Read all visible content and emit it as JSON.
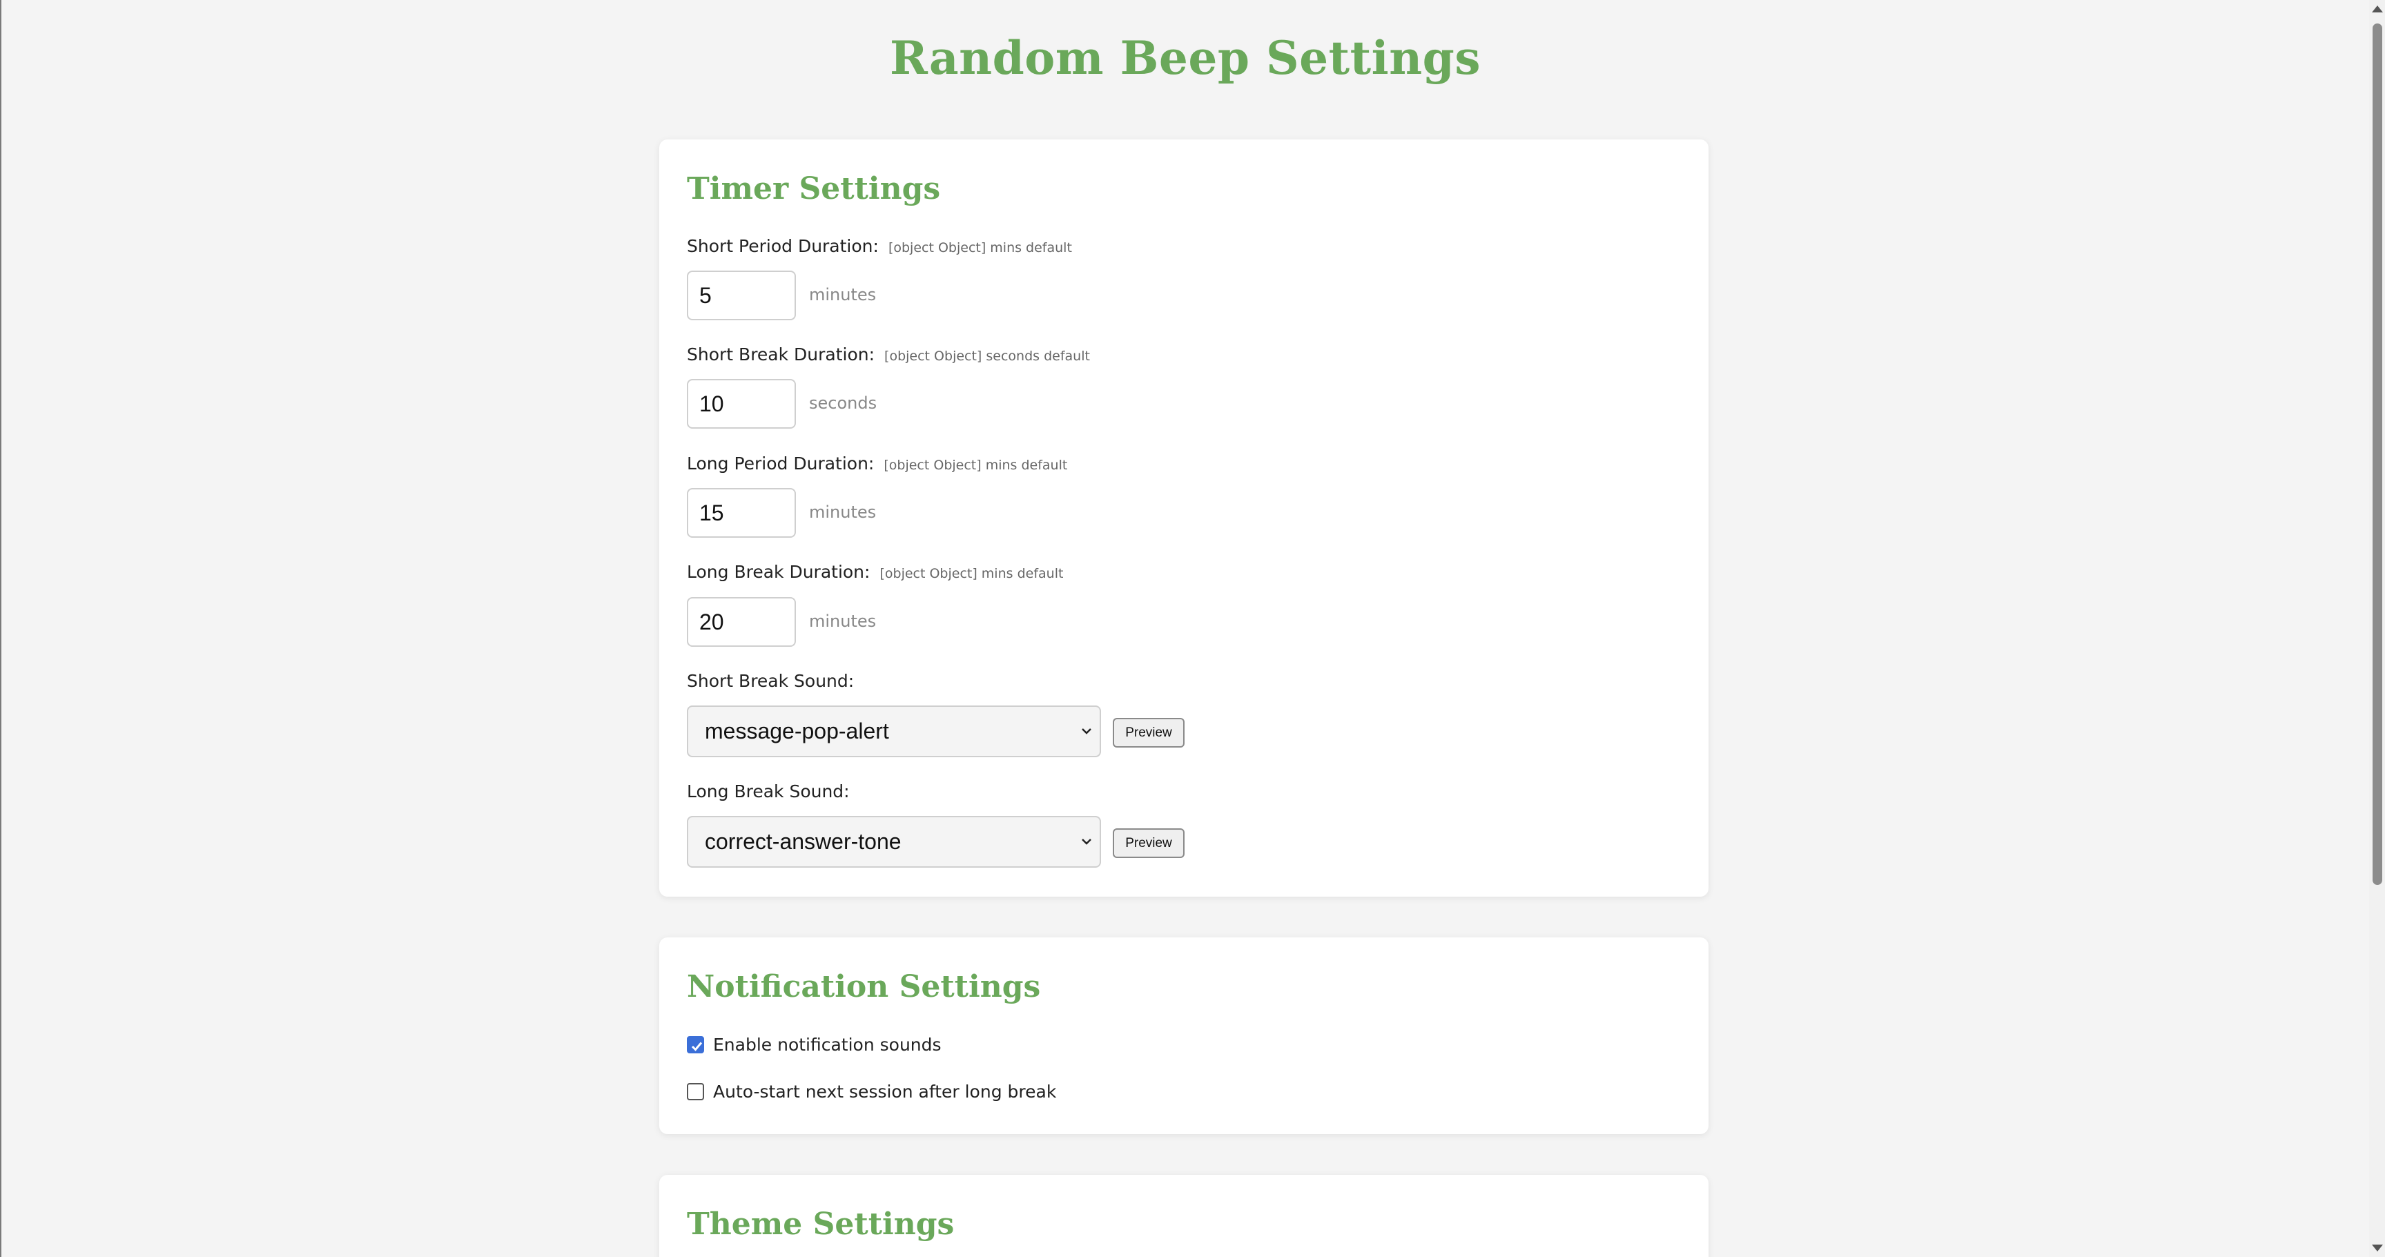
{
  "page_title": "Random Beep Settings",
  "timer": {
    "title": "Timer Settings",
    "fields": [
      {
        "label": "Short Period Duration:",
        "hint": "[object Object] mins default",
        "value": "5",
        "unit": "minutes"
      },
      {
        "label": "Short Break Duration:",
        "hint": "[object Object] seconds default",
        "value": "10",
        "unit": "seconds"
      },
      {
        "label": "Long Period Duration:",
        "hint": "[object Object] mins default",
        "value": "15",
        "unit": "minutes"
      },
      {
        "label": "Long Break Duration:",
        "hint": "[object Object] mins default",
        "value": "20",
        "unit": "minutes"
      }
    ],
    "sounds": [
      {
        "label": "Short Break Sound:",
        "selected": "message-pop-alert",
        "preview_label": "Preview"
      },
      {
        "label": "Long Break Sound:",
        "selected": "correct-answer-tone",
        "preview_label": "Preview"
      }
    ]
  },
  "notifications": {
    "title": "Notification Settings",
    "options": [
      {
        "label": "Enable notification sounds",
        "checked": true
      },
      {
        "label": "Auto-start next session after long break",
        "checked": false
      }
    ]
  },
  "theme": {
    "title": "Theme Settings"
  },
  "colors": {
    "accent": "#6aa85a",
    "checkbox_on": "#3b6fd8",
    "background": "#f4f4f4"
  },
  "icons": {
    "select_chevron": "chevron-down-icon",
    "checkmark": "check-icon",
    "scroll_up": "scroll-up-arrow-icon",
    "scroll_down": "scroll-down-arrow-icon"
  }
}
